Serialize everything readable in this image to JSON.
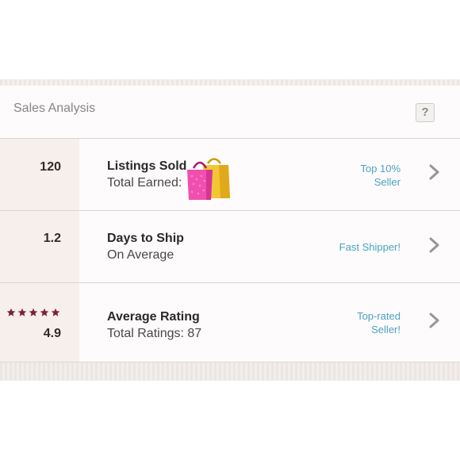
{
  "header": {
    "title": "Sales Analysis",
    "help_label": "?"
  },
  "rows": [
    {
      "value": "120",
      "title": "Listings Sold",
      "subtitle": "Total Earned:",
      "badge_line1": "Top 10%",
      "badge_line2": "Seller"
    },
    {
      "value": "1.2",
      "title": "Days to Ship",
      "subtitle": "On Average",
      "badge_line1": "Fast Shipper!",
      "badge_line2": ""
    },
    {
      "value": "4.9",
      "title": "Average Rating",
      "subtitle": "Total Ratings: 87",
      "badge_line1": "Top-rated",
      "badge_line2": "Seller!",
      "stars": 5
    }
  ],
  "colors": {
    "accent_link": "#4aa3c4",
    "star": "#7d2236",
    "chevron": "#9a9593"
  },
  "icons": [
    "help-icon",
    "chevron-right-icon",
    "star-icon",
    "shopping-bags-icon"
  ]
}
